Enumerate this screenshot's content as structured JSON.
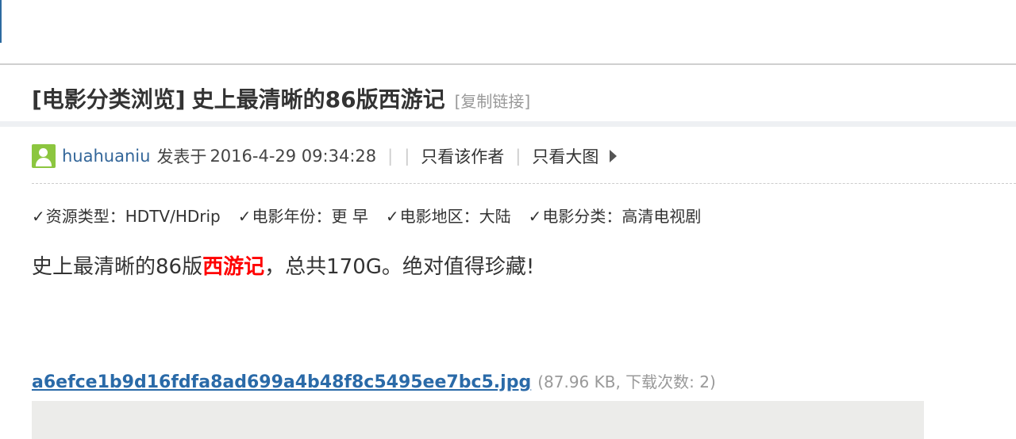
{
  "thread": {
    "category": "[电影分类浏览]",
    "title": "史上最清晰的86版西游记",
    "copy_link": "[复制链接]"
  },
  "post": {
    "author": "huahuaniu",
    "posted_label": "发表于",
    "posted_time": "2016-4-29 09:34:28",
    "only_author": "只看该作者",
    "only_images": "只看大图"
  },
  "meta": {
    "check": "✓",
    "resource_type": "资源类型：HDTV/HDrip",
    "movie_year": "电影年份：更 早",
    "movie_region": "电影地区：大陆",
    "movie_category": "电影分类：高清电视剧"
  },
  "content": {
    "before": "史上最清晰的86版",
    "highlight": "西游记",
    "after": "，总共170G。绝对值得珍藏!"
  },
  "attachment": {
    "filename": "a6efce1b9d16fdfa8ad699a4b48f8c5495ee7bc5.jpg",
    "info": "(87.96 KB, 下载次数: 2)"
  },
  "colors": {
    "link": "#336699",
    "highlight": "#ff0000",
    "avatar": "#8cc63f",
    "muted": "#999999"
  },
  "icons": {
    "avatar": "default-avatar-icon",
    "next": "triangle-right-icon",
    "check": "checkmark-icon"
  }
}
